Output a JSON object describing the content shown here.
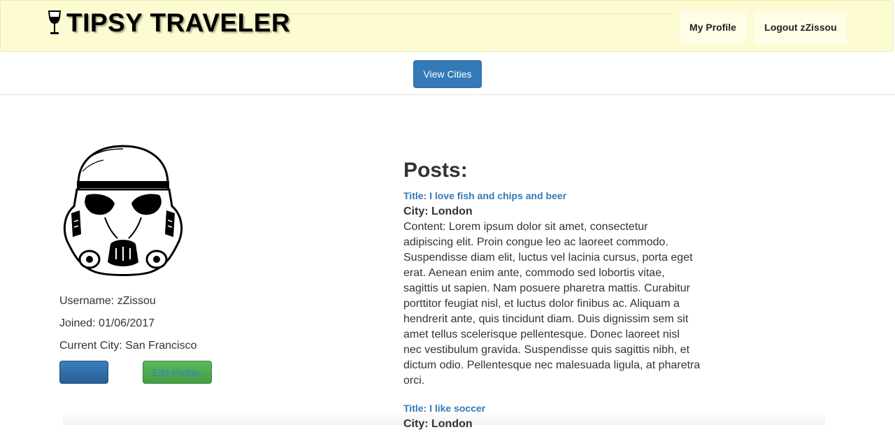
{
  "brand": {
    "name": "TIPSY TRAVELER",
    "icon": "wine-glass-icon"
  },
  "nav": {
    "my_profile": "My Profile",
    "logout": "Logout zZissou"
  },
  "subnav": {
    "view_cities": "View Cities"
  },
  "profile": {
    "avatar_icon": "stormtrooper-helmet-icon",
    "username": "Username: zZissou",
    "joined": "Joined: 01/06/2017",
    "current_city": "Current City: San Francisco",
    "logout_label": "Logout",
    "edit_label": "Edit Profile."
  },
  "posts": {
    "heading": "Posts:",
    "items": [
      {
        "title": "Title: I love fish and chips and beer",
        "city": "City: London",
        "content": "Content: Lorem ipsum dolor sit amet, consectetur adipiscing elit. Proin congue leo ac laoreet commodo. Suspendisse diam elit, luctus vel lacinia cursus, porta eget erat. Aenean enim ante, commodo sed lobortis vitae, sagittis ut sapien. Nam posuere pharetra mattis. Curabitur porttitor feugiat nisl, et luctus dolor finibus ac. Aliquam a hendrerit ante, quis tincidunt diam. Duis dignissim sem sit amet tellus scelerisque pellentesque. Donec laoreet nisl nec vestibulum gravida. Suspendisse quis sagittis nibh, et dictum odio. Pellentesque nec malesuada ligula, at pharetra orci."
      },
      {
        "title": "Title: I like soccer",
        "city": "City: London"
      }
    ]
  },
  "colors": {
    "navbar_bg": "#fdfbd1",
    "primary": "#337ab7",
    "success": "#5cb85c"
  }
}
